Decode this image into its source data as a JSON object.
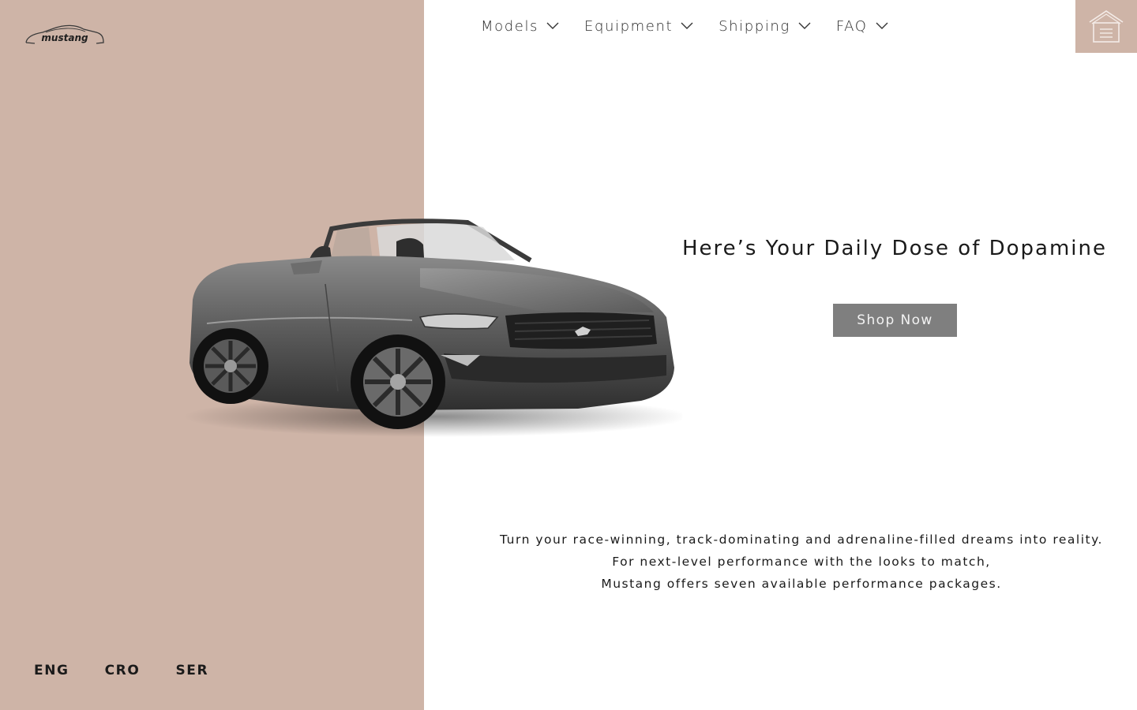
{
  "brand": {
    "logo_text": "mustang"
  },
  "nav": {
    "items": [
      {
        "label": "Models"
      },
      {
        "label": "Equipment"
      },
      {
        "label": "Shipping"
      },
      {
        "label": "FAQ"
      }
    ]
  },
  "hero": {
    "headline": "Here’s Your Daily Dose of Dopamine",
    "cta_label": "Shop Now",
    "body_lines": [
      "Turn your race-winning, track-dominating and adrenaline-filled dreams into reality.",
      "For next-level performance with the looks to match,",
      "Mustang offers seven available performance packages."
    ]
  },
  "languages": [
    "ENG",
    "CRO",
    "SER"
  ],
  "icons": {
    "menu": "home-menu-icon",
    "chevron": "chevron-down-icon"
  },
  "colors": {
    "panel": "#ceb4a7",
    "button": "#7f7f7f",
    "text": "#1a1a1a",
    "background": "#ffffff"
  }
}
